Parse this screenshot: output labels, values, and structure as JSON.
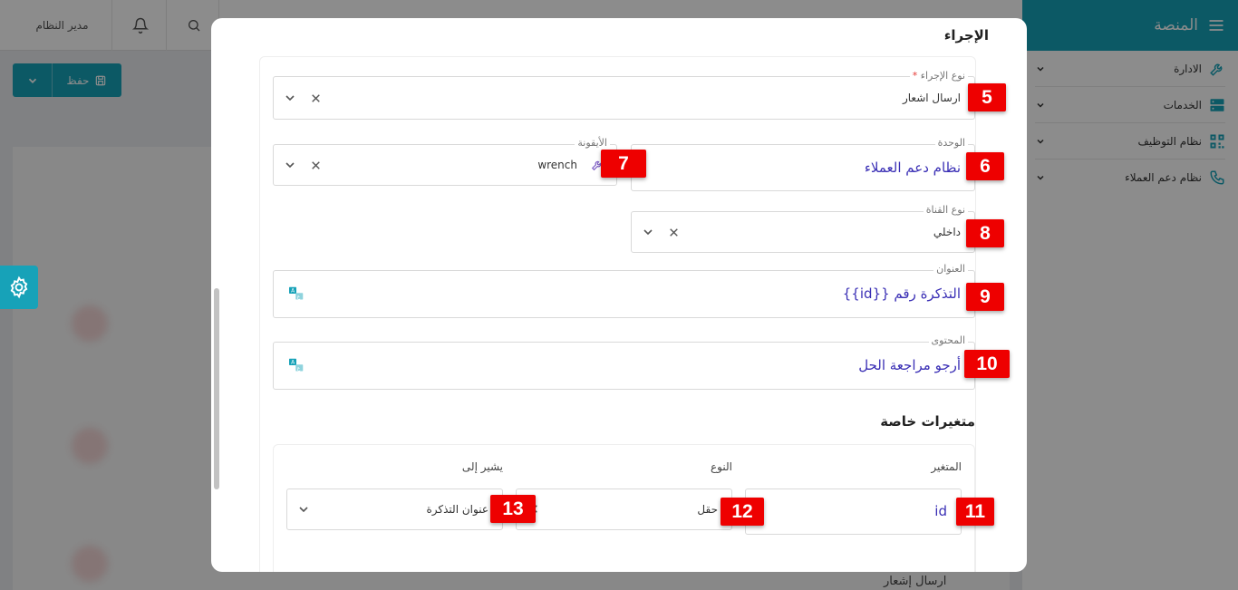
{
  "topbar": {
    "admin_label": "مدير النظام"
  },
  "sidebar": {
    "brand": "المنصة",
    "items": [
      {
        "label": "الادارة",
        "icon": "wrench-icon"
      },
      {
        "label": "الخدمات",
        "icon": "server-icon"
      },
      {
        "label": "نظام التوظيف",
        "icon": "qr-icon"
      },
      {
        "label": "نظام دعم العملاء",
        "icon": "phone-icon"
      }
    ]
  },
  "toolbar": {
    "save_label": "حفظ"
  },
  "background": {
    "row_text": "ارسال إشعار"
  },
  "modal": {
    "section_title": "الإجراء",
    "action_type": {
      "label": "نوع الإجراء",
      "required_mark": "*",
      "value": "ارسال اشعار",
      "badge": "5"
    },
    "unit": {
      "label": "الوحدة",
      "value": "نظام دعم العملاء",
      "badge": "6"
    },
    "icon_field": {
      "label": "الأيقونة",
      "value": "wrench",
      "badge": "7"
    },
    "channel_type": {
      "label": "نوع القناة",
      "value": "داخلي",
      "badge": "8"
    },
    "title_field": {
      "label": "العنوان",
      "value": "التذكرة رقم {{id}}",
      "badge": "9"
    },
    "content_field": {
      "label": "المحتوى",
      "value": "أرجو مراجعة الحل",
      "badge": "10"
    },
    "custom_vars": {
      "heading": "متغيرات خاصة",
      "columns": {
        "variable": "المتغير",
        "type": "النوع",
        "refers_to": "يشير إلى"
      },
      "row": {
        "variable": "id",
        "variable_badge": "11",
        "type": "حقل",
        "type_badge": "12",
        "refers_to": "عنوان التذكرة",
        "refers_badge": "13"
      }
    }
  },
  "colors": {
    "accent": "#17a2b8",
    "badge": "#ee0000",
    "link_text": "#3a2fb5"
  }
}
